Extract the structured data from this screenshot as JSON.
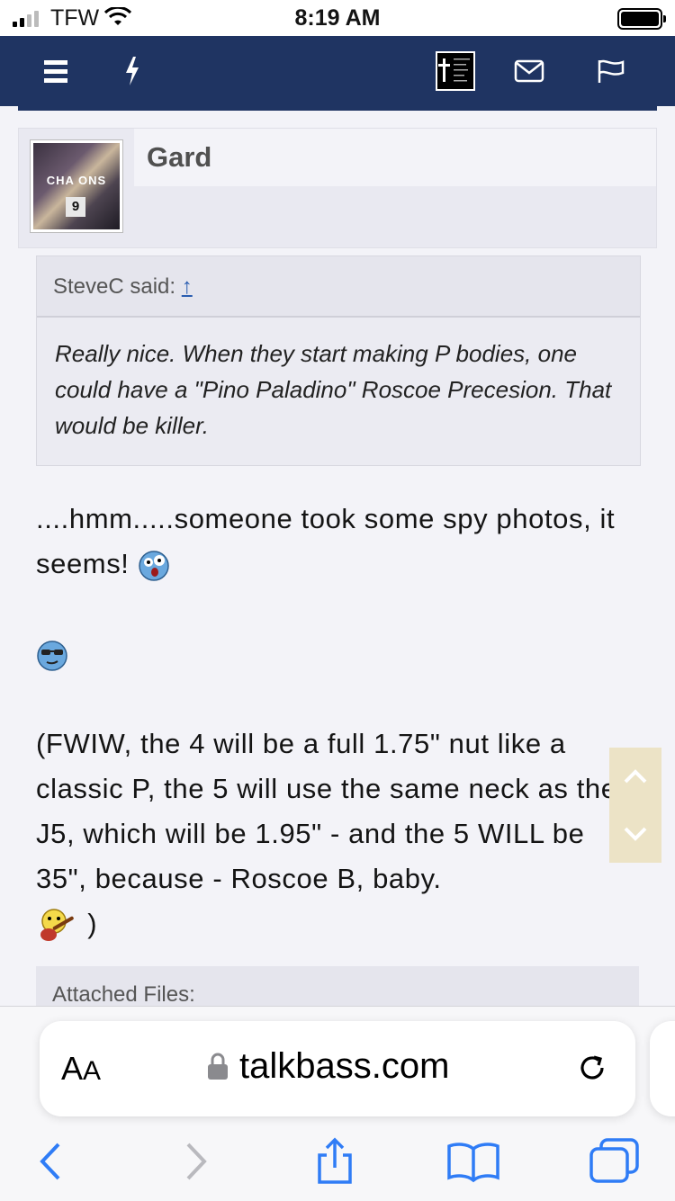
{
  "status_bar": {
    "carrier": "TFW",
    "time": "8:19 AM"
  },
  "nav": {
    "menu_icon": "hamburger-icon",
    "whats_new_icon": "lightning-icon",
    "logo_icon": "cross-logo-icon",
    "inbox_icon": "envelope-icon",
    "alerts_icon": "flag-icon"
  },
  "post": {
    "avatar_banner": "CHA  ONS",
    "avatar_number": "9",
    "username": "Gard",
    "quote": {
      "author": "SteveC said:",
      "arrow": "↑",
      "text": "Really nice. When they start making P bodies, one could have a \"Pino Paladino\" Roscoe Precesion. That would be killer."
    },
    "line1": "....hmm.....someone took some spy photos, it seems!",
    "line2": "(FWIW, the 4 will be a full 1.75\" nut like a classic P, the 5 will use the same neck as the J5, which will be 1.95\" - and the 5 WILL be 35\", because - Roscoe B, baby.",
    "line2_close": ")",
    "attached_label": "Attached Files:"
  },
  "browser": {
    "aa_label_big": "A",
    "aa_label_small": "A",
    "url": "talkbass.com",
    "icons": [
      "back-icon",
      "forward-icon",
      "share-icon",
      "bookmarks-icon",
      "tabs-icon",
      "reload-icon",
      "lock-icon"
    ]
  }
}
